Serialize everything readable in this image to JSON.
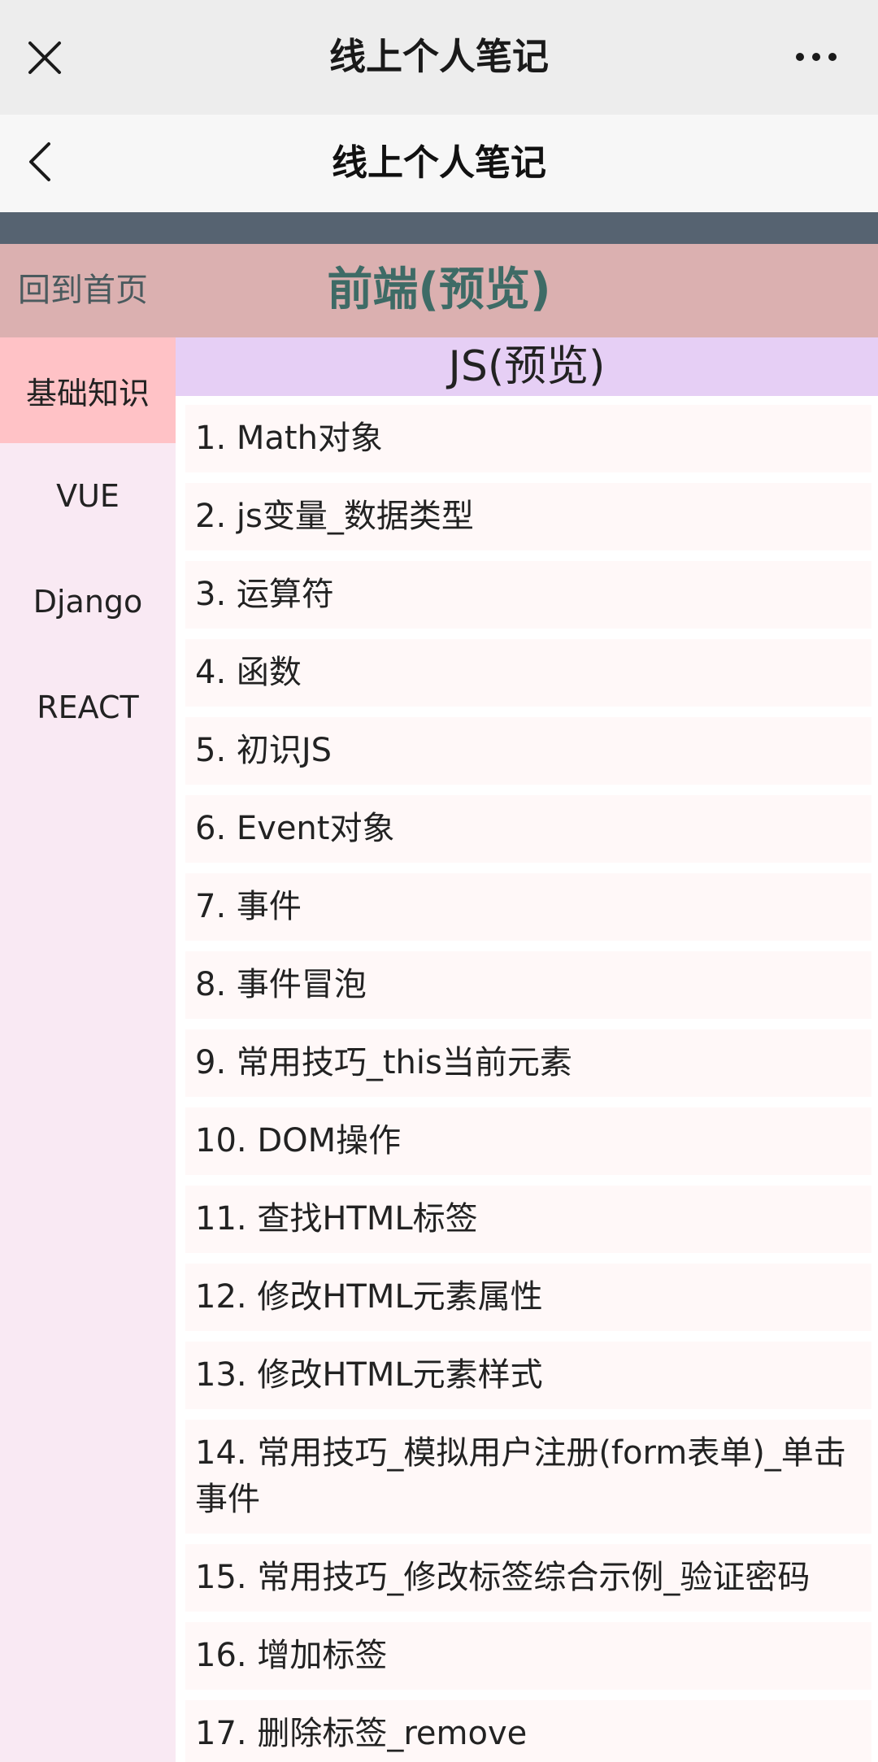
{
  "wechat_bar": {
    "title": "线上个人笔记"
  },
  "nav": {
    "title": "线上个人笔记"
  },
  "header": {
    "home_link": "回到首页",
    "title": "前端(预览)"
  },
  "sidebar": {
    "items": [
      {
        "label": "基础知识",
        "active": true
      },
      {
        "label": "VUE"
      },
      {
        "label": "Django"
      },
      {
        "label": "REACT"
      }
    ]
  },
  "content": {
    "title": "JS(预览)",
    "items": [
      "1. Math对象",
      "2. js变量_数据类型",
      "3. 运算符",
      "4. 函数",
      "5. 初识JS",
      "6. Event对象",
      "7. 事件",
      "8. 事件冒泡",
      "9. 常用技巧_this当前元素",
      "10. DOM操作",
      "11. 查找HTML标签",
      "12. 修改HTML元素属性",
      "13. 修改HTML元素样式",
      "14. 常用技巧_模拟用户注册(form表单)_单击事件",
      "15. 常用技巧_修改标签综合示例_验证密码",
      "16. 增加标签",
      "17. 删除标签_remove"
    ]
  },
  "colors": {
    "header_bg": "#dbb0b0",
    "header_title": "#3e6b66",
    "sidebar_bg": "#f9e9f3",
    "sidebar_active": "#ffc2c6",
    "content_title_bg": "#e6cff5",
    "strip": "#566371"
  }
}
